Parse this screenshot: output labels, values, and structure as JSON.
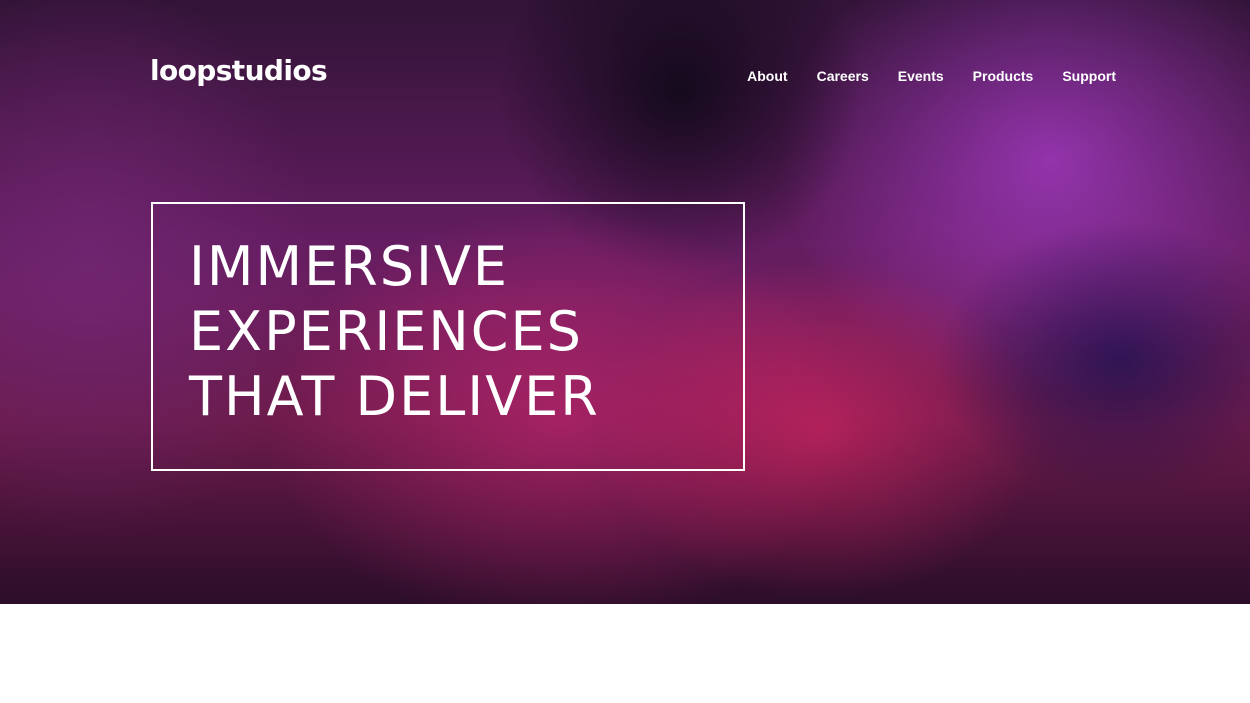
{
  "brand": {
    "logo_text": "loopstudios"
  },
  "nav": {
    "items": [
      {
        "label": "About"
      },
      {
        "label": "Careers"
      },
      {
        "label": "Events"
      },
      {
        "label": "Products"
      },
      {
        "label": "Support"
      }
    ]
  },
  "hero": {
    "headline_lines": [
      "IMMERSIVE",
      "EXPERIENCES",
      "THAT DELIVER"
    ]
  },
  "colors": {
    "text": "#ffffff",
    "page_background": "#ffffff",
    "hero_tint": "#7d1f55"
  }
}
